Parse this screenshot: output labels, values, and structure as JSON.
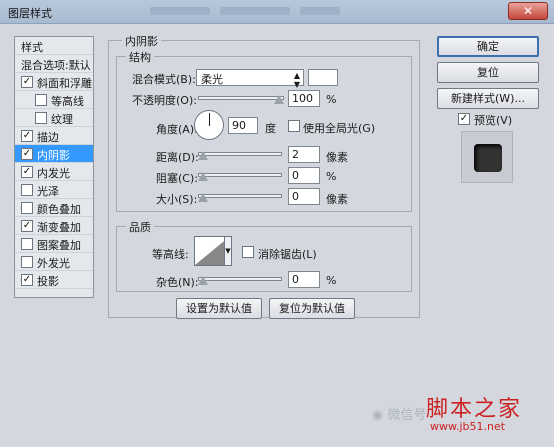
{
  "window": {
    "title": "图层样式",
    "close_symbol": "✕"
  },
  "styles_panel": {
    "header": "样式",
    "blending_options": "混合选项:默认",
    "items": [
      {
        "label": "斜面和浮雕",
        "checked": true,
        "sub": false
      },
      {
        "label": "等高线",
        "checked": false,
        "sub": true
      },
      {
        "label": "纹理",
        "checked": false,
        "sub": true
      },
      {
        "label": "描边",
        "checked": true,
        "sub": false
      },
      {
        "label": "内阴影",
        "checked": true,
        "sub": false,
        "selected": true
      },
      {
        "label": "内发光",
        "checked": true,
        "sub": false
      },
      {
        "label": "光泽",
        "checked": false,
        "sub": false
      },
      {
        "label": "颜色叠加",
        "checked": false,
        "sub": false
      },
      {
        "label": "渐变叠加",
        "checked": true,
        "sub": false
      },
      {
        "label": "图案叠加",
        "checked": false,
        "sub": false
      },
      {
        "label": "外发光",
        "checked": false,
        "sub": false
      },
      {
        "label": "投影",
        "checked": true,
        "sub": false
      }
    ]
  },
  "inner_shadow": {
    "title": "内阴影",
    "structure": {
      "title": "结构",
      "blend_mode_label": "混合模式(B):",
      "blend_mode_value": "柔光",
      "opacity_label": "不透明度(O):",
      "opacity_value": "100",
      "opacity_unit": "%",
      "opacity_fraction": 1.0,
      "angle_label": "角度(A):",
      "angle_value": "90",
      "angle_unit": "度",
      "global_light_label": "使用全局光(G)",
      "global_light_checked": false,
      "distance_label": "距离(D):",
      "distance_value": "2",
      "distance_unit": "像素",
      "distance_fraction": 0.0,
      "choke_label": "阻塞(C):",
      "choke_value": "0",
      "choke_unit": "%",
      "choke_fraction": 0.0,
      "size_label": "大小(S):",
      "size_value": "0",
      "size_unit": "像素",
      "size_fraction": 0.0
    },
    "quality": {
      "title": "品质",
      "contour_label": "等高线:",
      "antialias_label": "消除锯齿(L)",
      "antialias_checked": false,
      "noise_label": "杂色(N):",
      "noise_value": "0",
      "noise_unit": "%",
      "noise_fraction": 0.0
    },
    "make_default": "设置为默认值",
    "reset_default": "复位为默认值"
  },
  "buttons": {
    "ok": "确定",
    "reset": "复位",
    "new_style": "新建样式(W)...",
    "preview_label": "预览(V)",
    "preview_checked": true
  },
  "watermark": {
    "wechat": "微信号",
    "site_name": "脚本之家",
    "site_url": "www.jb51.net"
  },
  "colors": {
    "selection": "#3399ff",
    "dialog_bg": "#d4d8de",
    "brand_red": "#cc2222"
  }
}
